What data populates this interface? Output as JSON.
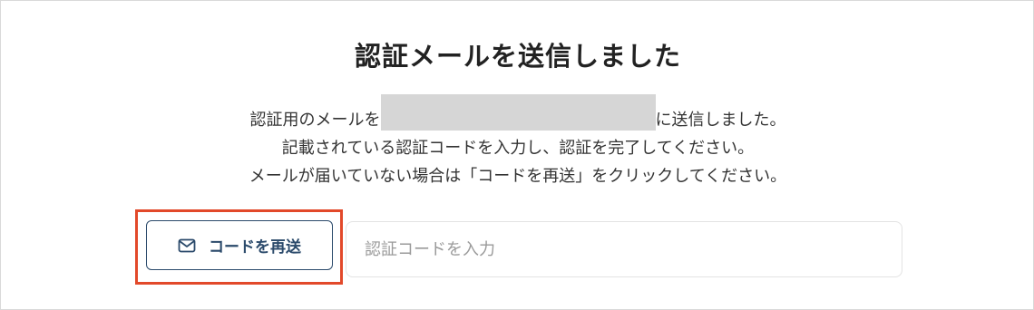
{
  "dialog": {
    "title": "認証メールを送信しました",
    "message": {
      "line1_prefix": "認証用のメールを",
      "line1_suffix": "に送信しました。",
      "line2": "記載されている認証コードを入力し、認証を完了してください。",
      "line3": "メールが届いていない場合は「コードを再送」をクリックしてください。"
    },
    "resend_button": {
      "label": "コードを再送",
      "icon": "mail-icon"
    },
    "code_input": {
      "placeholder": "認証コードを入力",
      "value": ""
    }
  },
  "colors": {
    "accent": "#2b4a6b",
    "highlight": "#e2492a",
    "redaction": "#d6d6d6"
  }
}
